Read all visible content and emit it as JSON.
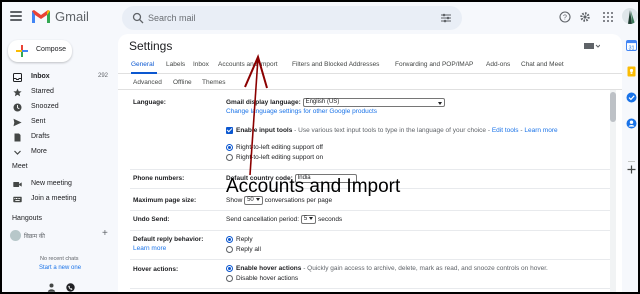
{
  "app": {
    "brand": "Gmail"
  },
  "search": {
    "placeholder": "Search mail"
  },
  "compose": {
    "label": "Compose"
  },
  "nav": [
    {
      "label": "Inbox",
      "count": "292",
      "icon": "inbox-icon"
    },
    {
      "label": "Starred",
      "icon": "star-icon"
    },
    {
      "label": "Snoozed",
      "icon": "clock-icon"
    },
    {
      "label": "Sent",
      "icon": "send-icon"
    },
    {
      "label": "Drafts",
      "icon": "draft-icon"
    },
    {
      "label": "More",
      "icon": "chevron-down-icon"
    }
  ],
  "meet": {
    "heading": "Meet",
    "items": [
      {
        "label": "New meeting",
        "icon": "video-icon"
      },
      {
        "label": "Join a meeting",
        "icon": "keyboard-icon"
      }
    ]
  },
  "hangouts": {
    "heading": "Hangouts",
    "user": "विक्रम की",
    "no_chats": "No recent chats",
    "start_new": "Start a new one"
  },
  "settings": {
    "title": "Settings",
    "tabs": [
      "General",
      "Labels",
      "Inbox",
      "Accounts and Import",
      "Filters and Blocked Addresses",
      "Forwarding and POP/IMAP",
      "Add-ons",
      "Chat and Meet"
    ],
    "tabs2": [
      "Advanced",
      "Offline",
      "Themes"
    ],
    "language": {
      "label": "Language:",
      "display_label": "Gmail display language:",
      "display_value": "English (US)",
      "change_link": "Change language settings for other Google products",
      "input_tools": "Enable input tools",
      "input_tools_desc": "- Use various text input tools to type in the language of your choice -",
      "edit_tools": "Edit tools",
      "learn_more": "Learn more",
      "rtl_off": "Right-to-left editing support off",
      "rtl_on": "Right-to-left editing support on"
    },
    "phone": {
      "label": "Phone numbers:",
      "text": "Default country code:",
      "value": "India"
    },
    "page_size": {
      "label": "Maximum page size:",
      "show": "Show",
      "value": "50",
      "suffix": "conversations per page"
    },
    "undo": {
      "label": "Undo Send:",
      "text": "Send cancellation period:",
      "value": "5",
      "suffix": "seconds"
    },
    "reply": {
      "label": "Default reply behavior:",
      "learn_more": "Learn more",
      "opt1": "Reply",
      "opt2": "Reply all"
    },
    "hover": {
      "label": "Hover actions:",
      "opt1": "Enable hover actions",
      "opt1_desc": "- Quickly gain access to archive, delete, mark as read, and snooze controls on hover.",
      "opt2": "Disable hover actions"
    }
  },
  "annotation": {
    "text": "Accounts and Import"
  },
  "colors": {
    "accent": "#0b57d0",
    "link": "#1a73e8",
    "background": "#f6f8fc",
    "annotation_arrow": "#8b0000"
  }
}
